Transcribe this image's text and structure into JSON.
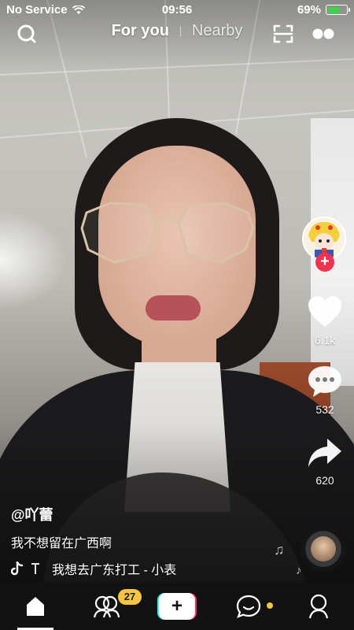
{
  "status_bar": {
    "carrier": "No Service",
    "time": "09:56",
    "battery": "69%",
    "battery_level": 0.69
  },
  "top_nav": {
    "tabs": [
      {
        "label": "For you",
        "active": true
      },
      {
        "label": "Nearby",
        "active": false
      }
    ]
  },
  "rail": {
    "likes": "6.1k",
    "comments": "532",
    "shares": "620",
    "follow_symbol": "+"
  },
  "caption": {
    "username": "@吖蕾",
    "description": "我不想留在广西啊",
    "music": "我想去广东打工 - 小表"
  },
  "bottom_bar": {
    "friends_badge": "27",
    "create_symbol": "+"
  },
  "colors": {
    "accent_red": "#fe2c55",
    "accent_cyan": "#25f4ee",
    "badge_yellow": "#f6c542"
  }
}
